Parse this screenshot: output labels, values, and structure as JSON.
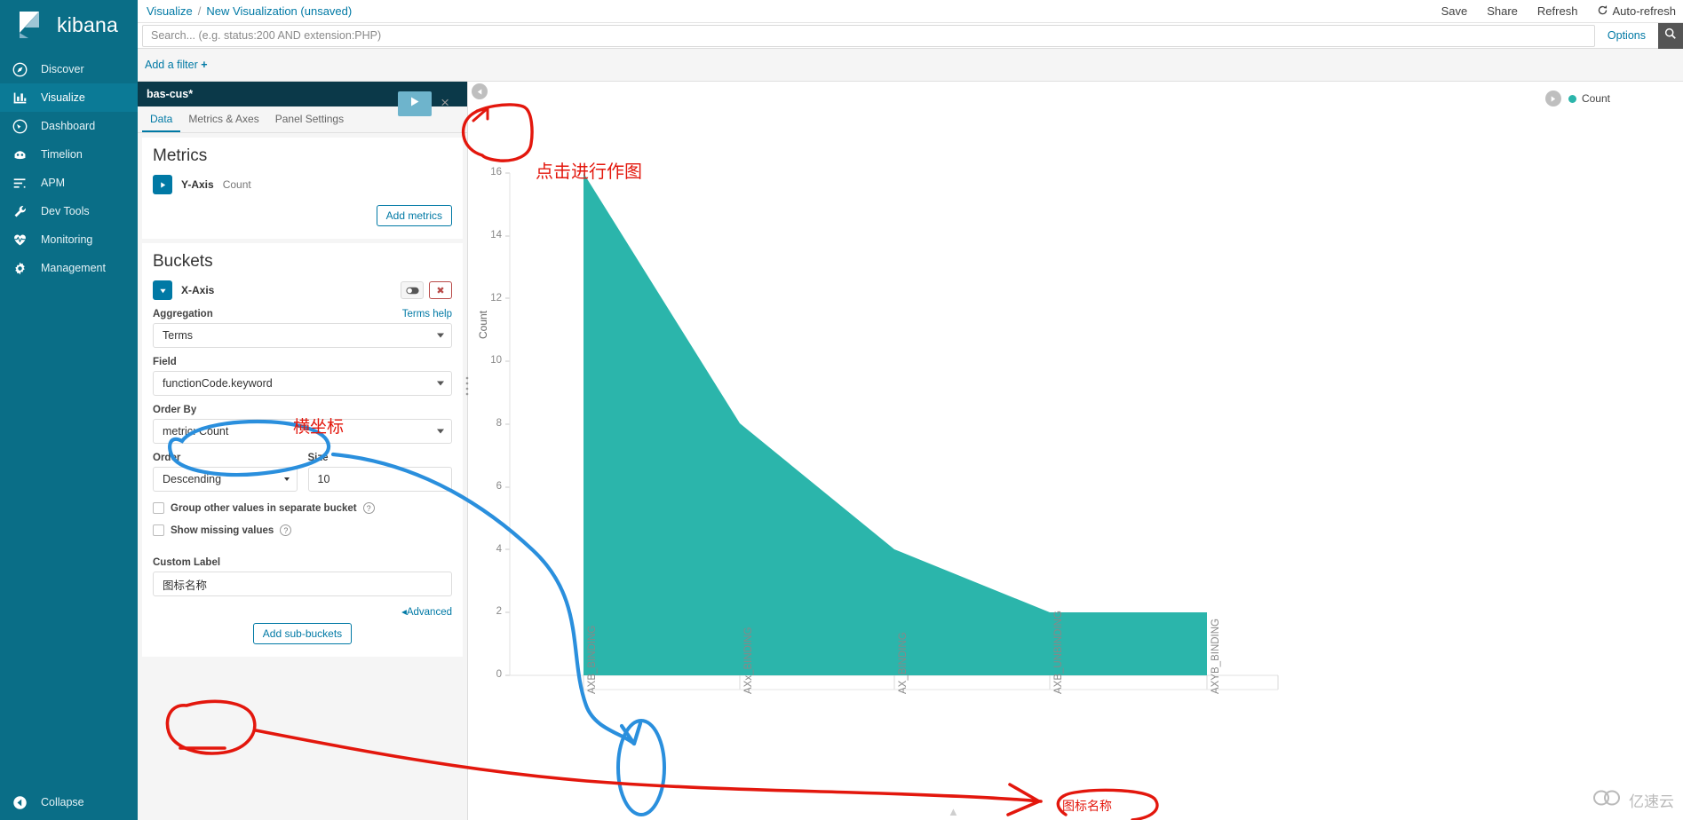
{
  "app": {
    "brand": "kibana"
  },
  "sidebar": {
    "items": [
      {
        "label": "Discover",
        "icon": "compass-icon",
        "active": false
      },
      {
        "label": "Visualize",
        "icon": "bar-chart-icon",
        "active": true
      },
      {
        "label": "Dashboard",
        "icon": "dashboard-icon",
        "active": false
      },
      {
        "label": "Timelion",
        "icon": "timelion-icon",
        "active": false
      },
      {
        "label": "APM",
        "icon": "apm-icon",
        "active": false
      },
      {
        "label": "Dev Tools",
        "icon": "wrench-icon",
        "active": false
      },
      {
        "label": "Monitoring",
        "icon": "heart-pulse-icon",
        "active": false
      },
      {
        "label": "Management",
        "icon": "gear-icon",
        "active": false
      }
    ],
    "collapse_label": "Collapse"
  },
  "topbar": {
    "breadcrumb_root": "Visualize",
    "breadcrumb_sep": "/",
    "breadcrumb_current": "New Visualization (unsaved)",
    "save_label": "Save",
    "share_label": "Share",
    "refresh_label": "Refresh",
    "autorefresh_label": "Auto-refresh"
  },
  "search": {
    "value": "",
    "placeholder": "Search... (e.g. status:200 AND extension:PHP)",
    "options_label": "Options",
    "search_icon": "search-icon"
  },
  "filterbar": {
    "add_filter_label": "Add a filter",
    "plus": "+"
  },
  "editor": {
    "index_pattern": "bas-cus*",
    "tabs": [
      {
        "label": "Data",
        "active": true
      },
      {
        "label": "Metrics & Axes",
        "active": false
      },
      {
        "label": "Panel Settings",
        "active": false
      }
    ],
    "apply_label": "▶",
    "discard_label": "×",
    "metrics": {
      "title": "Metrics",
      "agg_label": "Y-Axis",
      "agg_value": "Count",
      "add_metrics_label": "Add metrics"
    },
    "buckets": {
      "title": "Buckets",
      "agg_label": "X-Axis",
      "terms_help_label": "Terms help",
      "aggregation_label": "Aggregation",
      "aggregation_value": "Terms",
      "field_label": "Field",
      "field_value": "functionCode.keyword",
      "order_by_label": "Order By",
      "order_by_value": "metric: Count",
      "order_label": "Order",
      "order_value": "Descending",
      "size_label": "Size",
      "size_value": "10",
      "group_other_label": "Group other values in separate bucket",
      "show_missing_label": "Show missing values",
      "custom_label_label": "Custom Label",
      "custom_label_value": "图标名称",
      "advanced_label": "Advanced",
      "add_subbuckets_label": "Add sub-buckets"
    }
  },
  "legend": {
    "entry_label": "Count",
    "color": "#2bb5ab"
  },
  "annotations": {
    "click_to_plot": "点击进行作图",
    "x_axis_note": "横坐标",
    "chart_label_note": "图标名称"
  },
  "watermark": {
    "text": "亿速云"
  },
  "chart_data": {
    "type": "area",
    "title": "",
    "xlabel": "",
    "ylabel": "Count",
    "categories": [
      "AXB_BINDING",
      "AXx_BINDING",
      "AX_BINDING",
      "AXB_UNBINDING",
      "AXYB_BINDING"
    ],
    "values": [
      16,
      8,
      4,
      2,
      2
    ],
    "series": [
      {
        "name": "Count",
        "color": "#2bb5ab",
        "values": [
          16,
          8,
          4,
          2,
          2
        ]
      }
    ],
    "ylim": [
      0,
      16
    ],
    "yticks": [
      0,
      2,
      4,
      6,
      8,
      10,
      12,
      14,
      16
    ],
    "grid": false,
    "legend_position": "top-right"
  }
}
